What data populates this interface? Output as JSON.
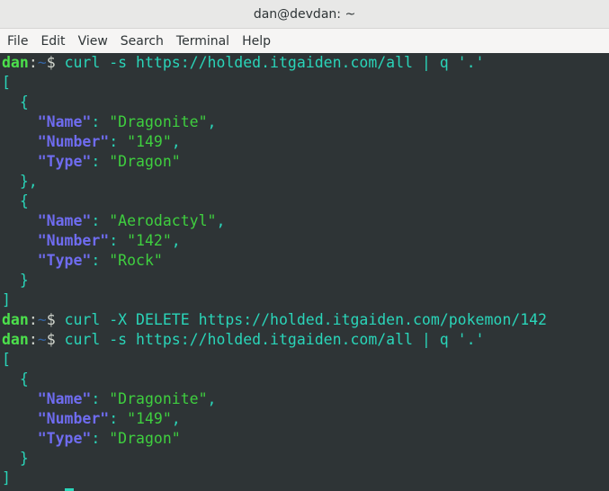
{
  "window": {
    "title": "dan@devdan: ~"
  },
  "menu": [
    "File",
    "Edit",
    "View",
    "Search",
    "Terminal",
    "Help"
  ],
  "terminal": {
    "user": "dan",
    "path": "~",
    "symbol": "$",
    "cmd1": "curl -s https://holded.itgaiden.com/all | q '.'",
    "cmd2": "curl -X DELETE https://holded.itgaiden.com/pokemon/142",
    "cmd3": "curl -s https://holded.itgaiden.com/all | q '.'",
    "key_name": "\"Name\"",
    "key_number": "\"Number\"",
    "key_type": "\"Type\"",
    "out1": [
      {
        "name": "\"Dragonite\"",
        "number": "\"149\"",
        "type": "\"Dragon\""
      },
      {
        "name": "\"Aerodactyl\"",
        "number": "\"142\"",
        "type": "\"Rock\""
      }
    ],
    "out2": [
      {
        "name": "\"Dragonite\"",
        "number": "\"149\"",
        "type": "\"Dragon\""
      }
    ]
  }
}
